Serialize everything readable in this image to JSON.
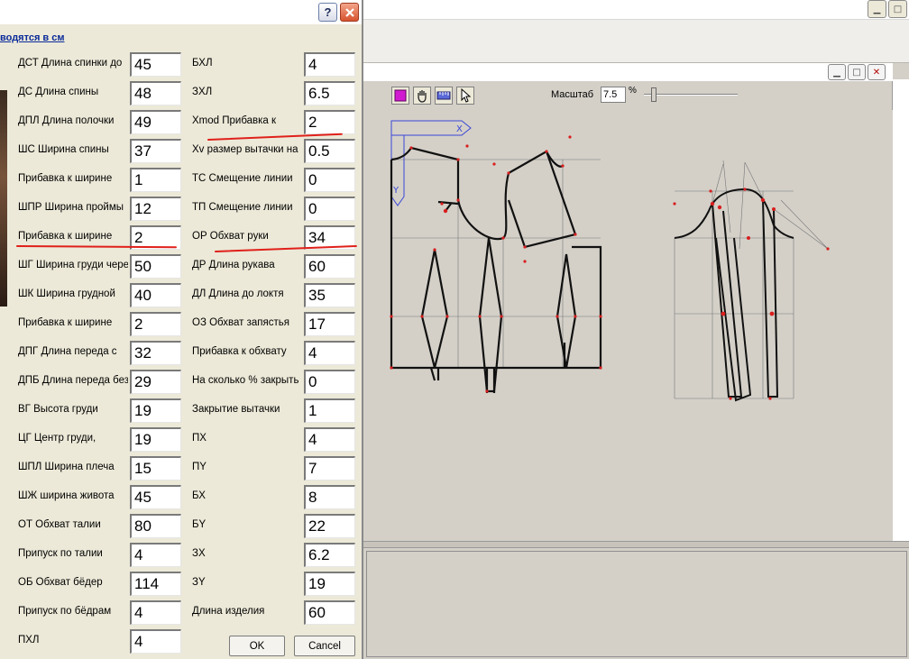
{
  "dialog": {
    "help_label": "?",
    "header": "водятся в см",
    "ok_label": "OK",
    "cancel_label": "Cancel",
    "left_fields": [
      {
        "label": "ДСТ Длина спинки до",
        "value": "45"
      },
      {
        "label": "ДС Длина спины",
        "value": "48"
      },
      {
        "label": "ДПЛ Длина полочки",
        "value": "49"
      },
      {
        "label": "ШС Ширина спины",
        "value": "37"
      },
      {
        "label": "Прибавка к ширине",
        "value": "1"
      },
      {
        "label": "ШПР Ширина проймы",
        "value": "12"
      },
      {
        "label": "Прибавка к ширине",
        "value": "2"
      },
      {
        "label": "ШГ Ширина груди через",
        "value": "50"
      },
      {
        "label": "ШК Ширина грудной",
        "value": "40"
      },
      {
        "label": "Прибавка к ширине",
        "value": "2"
      },
      {
        "label": "ДПГ Длина переда с",
        "value": "32"
      },
      {
        "label": "ДПБ Длина переда без",
        "value": "29"
      },
      {
        "label": "ВГ Высота груди",
        "value": "19"
      },
      {
        "label": "ЦГ Центр груди,",
        "value": "19"
      },
      {
        "label": "ШПЛ Ширина плеча",
        "value": "15"
      },
      {
        "label": "ШЖ ширина живота",
        "value": "45"
      },
      {
        "label": "ОТ Обхват талии",
        "value": "80"
      },
      {
        "label": "Припуск по талии",
        "value": "4"
      },
      {
        "label": "ОБ Обхват бёдер",
        "value": "114"
      },
      {
        "label": "Припуск по бёдрам",
        "value": "4"
      },
      {
        "label": "ПХЛ",
        "value": "4"
      }
    ],
    "right_fields": [
      {
        "label": "БХЛ",
        "value": "4"
      },
      {
        "label": "ЗХЛ",
        "value": "6.5"
      },
      {
        "label": "Xmod Прибавка к",
        "value": "2"
      },
      {
        "label": "Xv размер вытачки на",
        "value": "0.5"
      },
      {
        "label": "ТС Смещение линии",
        "value": "0"
      },
      {
        "label": "ТП Смещение линии",
        "value": "0"
      },
      {
        "label": "ОР Обхват руки",
        "value": "34"
      },
      {
        "label": "ДР Длина рукава",
        "value": "60"
      },
      {
        "label": "ДЛ Длина до локтя",
        "value": "35"
      },
      {
        "label": "ОЗ Обхват запястья",
        "value": "17"
      },
      {
        "label": "Прибавка к обхвату",
        "value": "4"
      },
      {
        "label": "На сколько % закрыть",
        "value": "0"
      },
      {
        "label": "Закрытие вытачки",
        "value": "1"
      },
      {
        "label": "ПХ",
        "value": "4"
      },
      {
        "label": "ПY",
        "value": "7"
      },
      {
        "label": "БХ",
        "value": "8"
      },
      {
        "label": "БY",
        "value": "22"
      },
      {
        "label": "ЗХ",
        "value": "6.2"
      },
      {
        "label": "ЗY",
        "value": "19"
      },
      {
        "label": "Длина изделия",
        "value": "60"
      }
    ]
  },
  "pattern_window": {
    "scale_label": "Масштаб",
    "scale_value": "7.5",
    "scale_unit": "%",
    "axis_x_label": "X",
    "axis_y_label": "Y",
    "tools": [
      "select-color-icon",
      "hand-pan-icon",
      "ruler-icon",
      "pointer-arrow-icon"
    ]
  },
  "colors": {
    "annotation_red": "#e0201a",
    "header_blue": "#0a2a9a",
    "axis_blue": "#3a46d8",
    "pattern_line": "#111111"
  }
}
